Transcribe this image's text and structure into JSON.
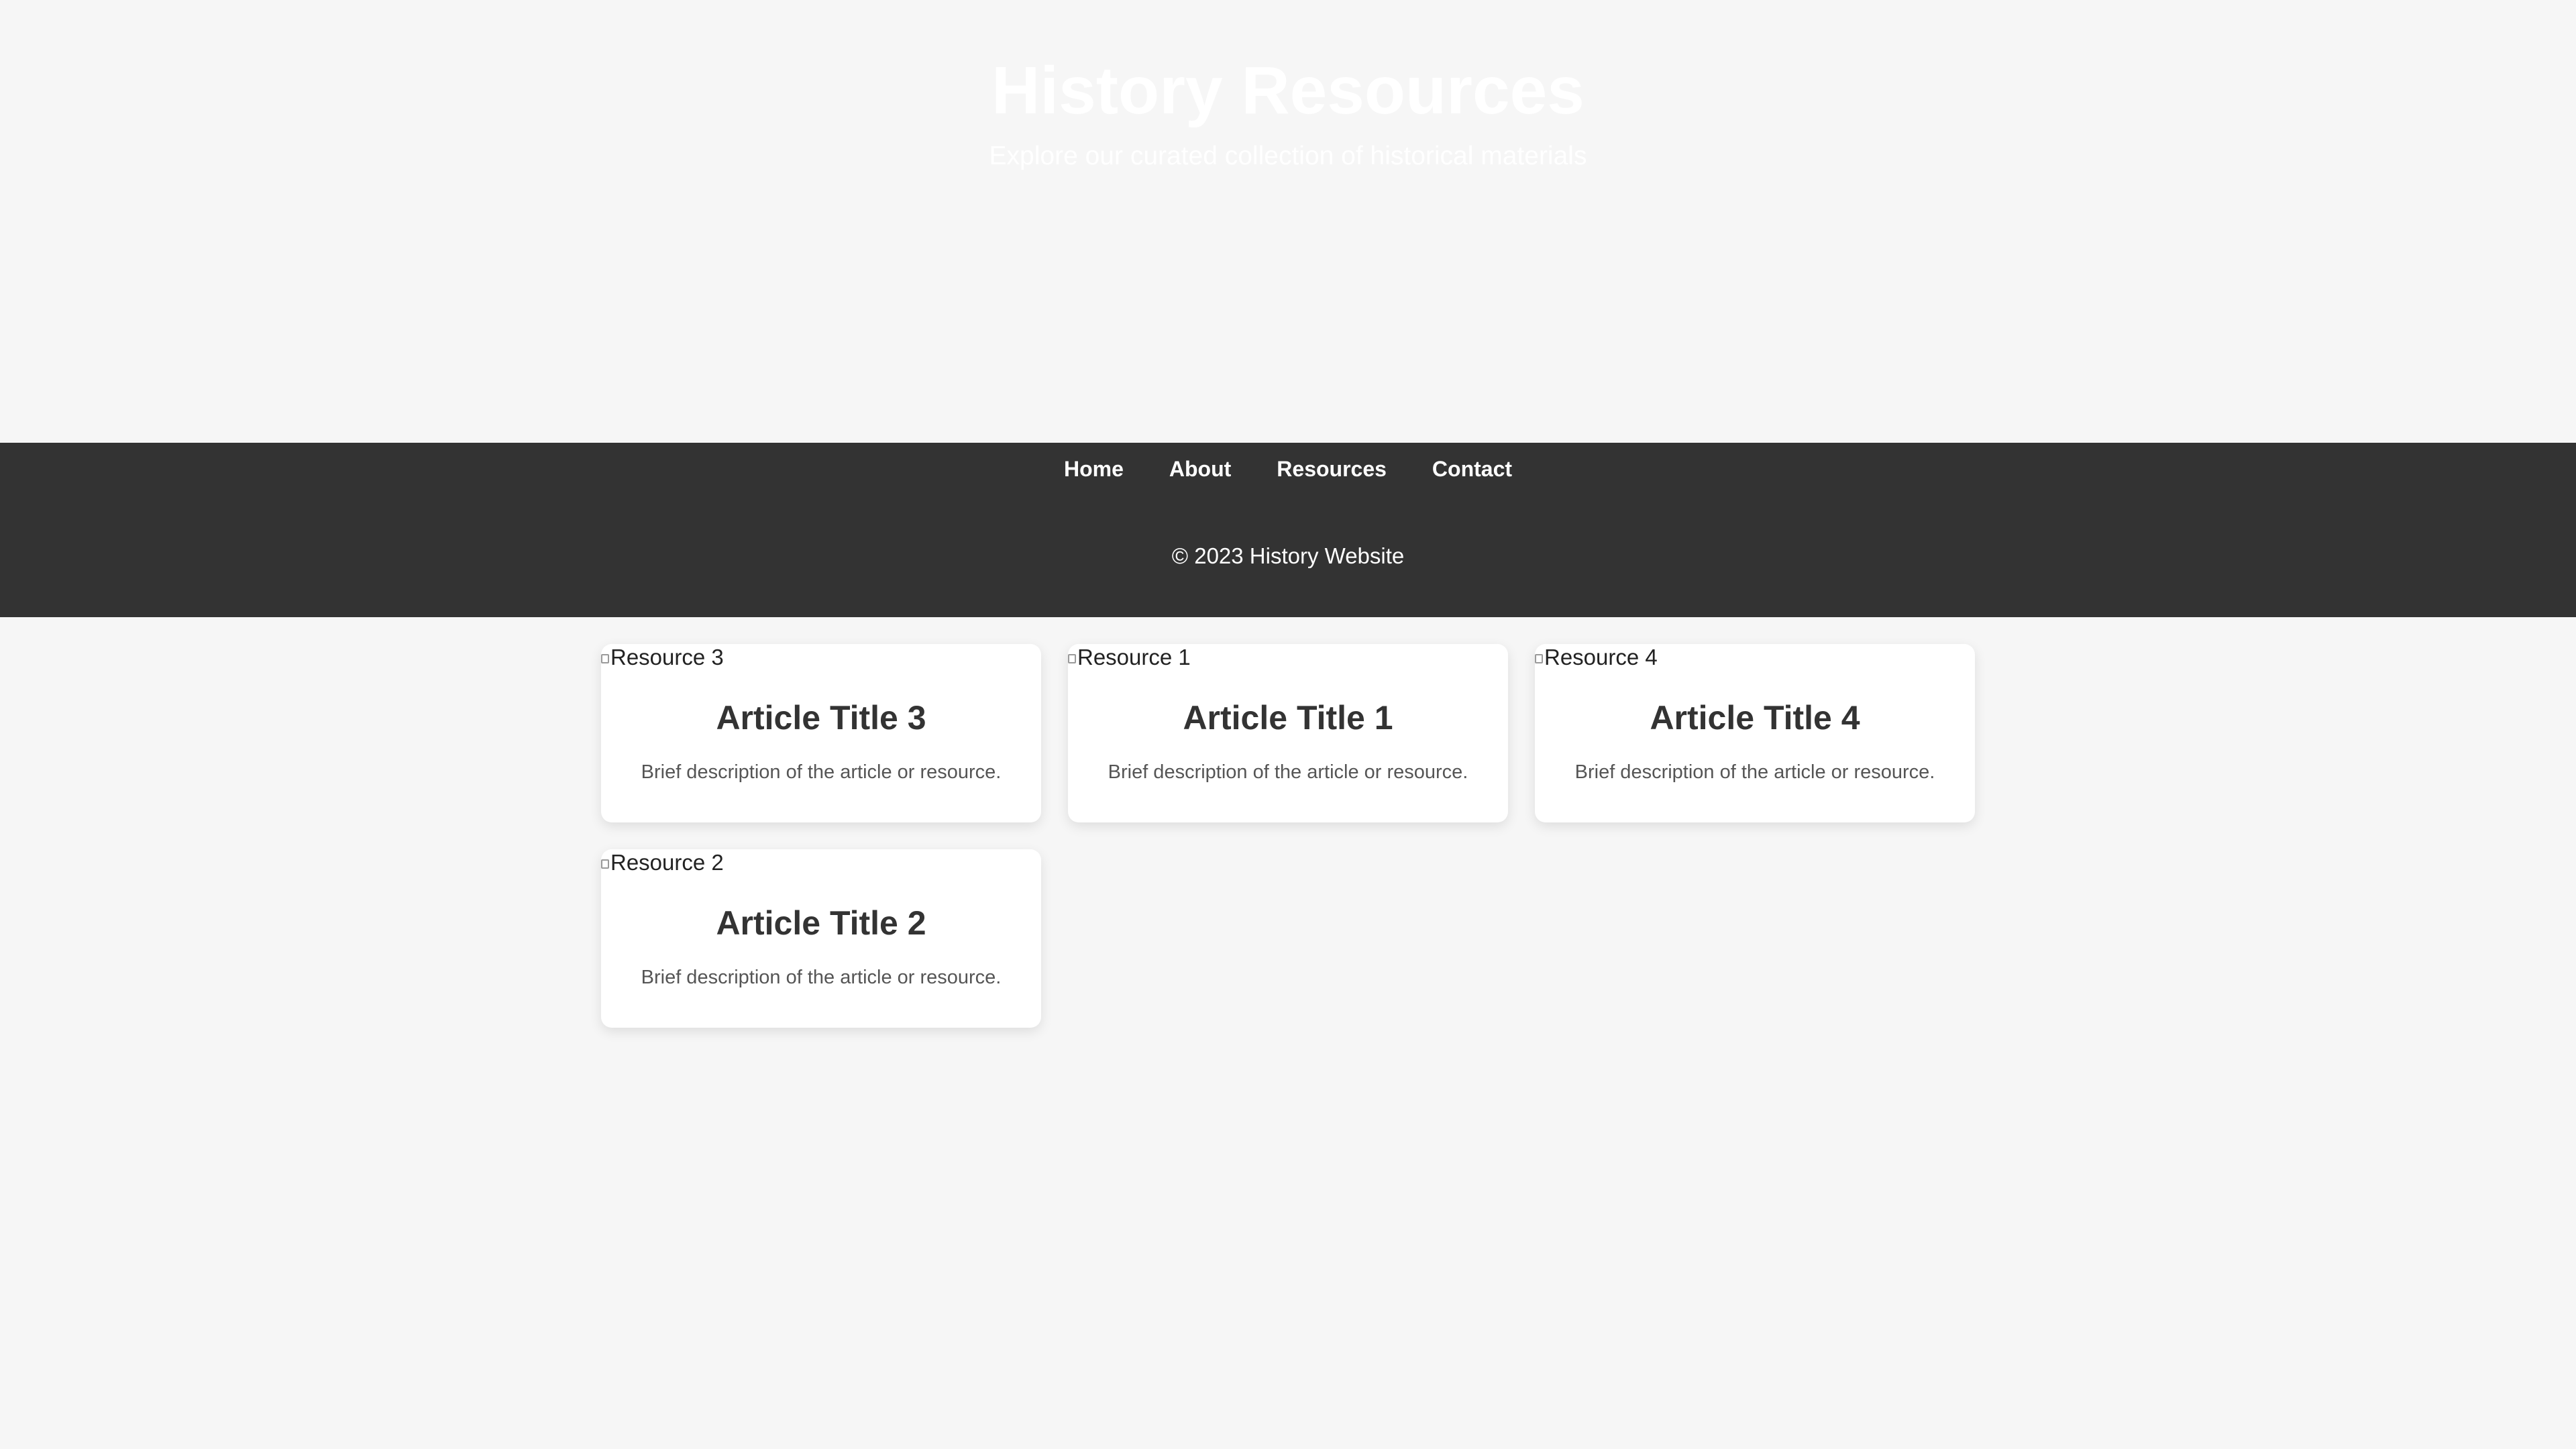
{
  "hero": {
    "title": "History Resources",
    "subtitle": "Explore our curated collection of historical materials"
  },
  "nav": {
    "items": [
      {
        "label": "Home"
      },
      {
        "label": "About"
      },
      {
        "label": "Resources"
      },
      {
        "label": "Contact"
      }
    ]
  },
  "footer": {
    "text": "© 2023 History Website"
  },
  "cards": [
    {
      "image_alt": "Resource 3",
      "title": "Article Title 3",
      "description": "Brief description of the article or resource."
    },
    {
      "image_alt": "Resource 1",
      "title": "Article Title 1",
      "description": "Brief description of the article or resource."
    },
    {
      "image_alt": "Resource 4",
      "title": "Article Title 4",
      "description": "Brief description of the article or resource."
    },
    {
      "image_alt": "Resource 2",
      "title": "Article Title 2",
      "description": "Brief description of the article or resource."
    }
  ],
  "colors": {
    "page_background": "#f6f6f6",
    "dark_band": "#333333",
    "card_background": "#ffffff",
    "title_text": "#333333",
    "description_text": "#555555"
  },
  "icons": {
    "card_image": "broken-image-icon"
  }
}
